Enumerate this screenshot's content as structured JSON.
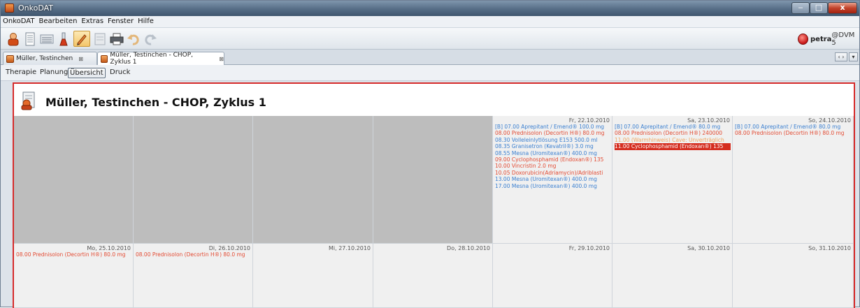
{
  "window": {
    "title": "OnkoDAT"
  },
  "menu": [
    "OnkoDAT",
    "Bearbeiten",
    "Extras",
    "Fenster",
    "Hilfe"
  ],
  "user": {
    "name": "petra",
    "host": "@DVM 5"
  },
  "doc_tabs": [
    {
      "label": "Müller, Testinchen",
      "close": "⊠",
      "active": false
    },
    {
      "label": "Müller, Testinchen - CHOP, Zyklus 1",
      "close": "⊠",
      "active": true
    }
  ],
  "sub_tabs": [
    {
      "label": "Therapie",
      "active": false
    },
    {
      "label": "Planung",
      "active": false
    },
    {
      "label": "Übersicht",
      "active": true
    },
    {
      "label": "Druck",
      "active": false
    }
  ],
  "page_title": "Müller, Testinchen - CHOP, Zyklus 1",
  "week1": [
    {
      "date": "",
      "entries": []
    },
    {
      "date": "",
      "entries": []
    },
    {
      "date": "",
      "entries": []
    },
    {
      "date": "",
      "entries": []
    },
    {
      "date": "Fr, 22.10.2010",
      "entries": [
        {
          "text": "[B] 07.00 Aprepitant / Emend® 100.0 mg",
          "color": "blue"
        },
        {
          "text": "08.00 Prednisolon (Decortin H®) 80.0 mg",
          "color": "red"
        },
        {
          "text": "08.30 Volleleinlytlösung E153 500.0 ml",
          "color": "blue"
        },
        {
          "text": "08.35 Granisetron (Kevatril®) 3.0 mg",
          "color": "blue"
        },
        {
          "text": "08.55 Mesna (Uromitexan®) 400.0 mg",
          "color": "blue"
        },
        {
          "text": "09.00 Cyclophosphamid (Endoxan®) 135",
          "color": "red"
        },
        {
          "text": "10.00 Vincristin 2.0 mg",
          "color": "red"
        },
        {
          "text": "10.05 Doxorubicin(Adriamycin)/Adriblasti",
          "color": "red"
        },
        {
          "text": "13.00 Mesna (Uromitexan®) 400.0 mg",
          "color": "blue"
        },
        {
          "text": "17.00 Mesna (Uromitexan®) 400.0 mg",
          "color": "blue"
        }
      ]
    },
    {
      "date": "Sa, 23.10.2010",
      "entries": [
        {
          "text": "[B] 07.00 Aprepitant / Emend® 80.0 mg",
          "color": "blue"
        },
        {
          "text": "08.00 Prednisolon (Decortin H®) 240000",
          "color": "red"
        },
        {
          "text": "11.00 (Warmhinweis) Cave: Unverträglich",
          "color": "orange"
        },
        {
          "text": "11.00 Cyclophosphamid (Endoxan®) 135",
          "color": "hl"
        }
      ]
    },
    {
      "date": "So, 24.10.2010",
      "entries": [
        {
          "text": "[B] 07.00 Aprepitant / Emend® 80.0 mg",
          "color": "blue"
        },
        {
          "text": "08.00 Prednisolon (Decortin H®) 80.0 mg",
          "color": "red"
        }
      ]
    }
  ],
  "week2": [
    {
      "date": "Mo, 25.10.2010",
      "entries": [
        {
          "text": "08.00 Prednisolon (Decortin H®) 80.0 mg",
          "color": "red"
        }
      ]
    },
    {
      "date": "Di, 26.10.2010",
      "entries": [
        {
          "text": "08.00 Prednisolon (Decortin H®) 80.0 mg",
          "color": "red"
        }
      ]
    },
    {
      "date": "Mi, 27.10.2010",
      "entries": []
    },
    {
      "date": "Do, 28.10.2010",
      "entries": []
    },
    {
      "date": "Fr, 29.10.2010",
      "entries": []
    },
    {
      "date": "Sa, 30.10.2010",
      "entries": []
    },
    {
      "date": "So, 31.10.2010",
      "entries": []
    }
  ],
  "colors": {
    "accent_border": "#d62b2b",
    "blue_entry": "#3a7fd0",
    "red_entry": "#e34b33",
    "highlight": "#d52e20"
  }
}
